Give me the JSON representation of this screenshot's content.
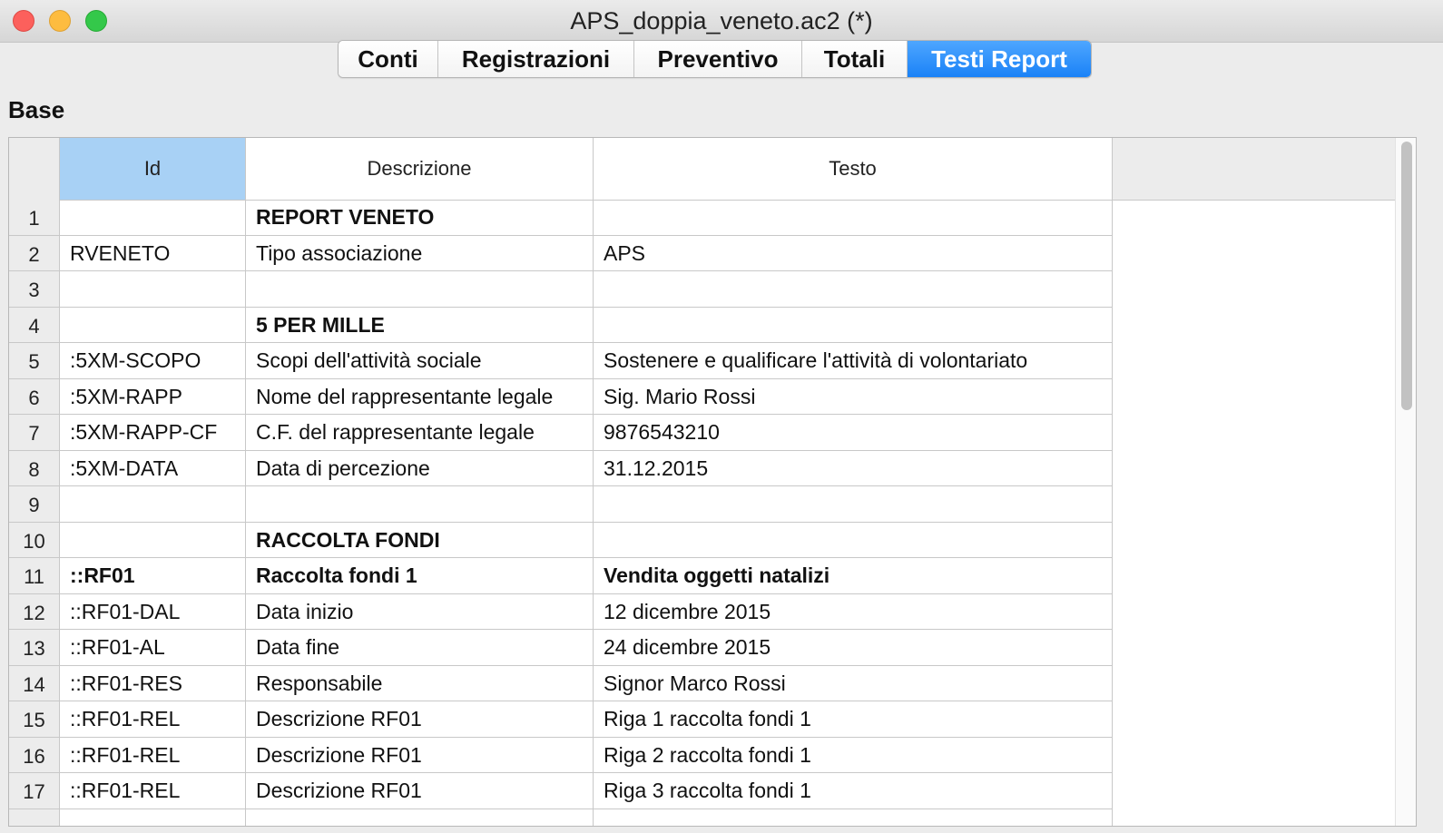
{
  "window": {
    "title": "APS_doppia_veneto.ac2 (*)"
  },
  "tabs": [
    {
      "label": "Conti",
      "active": false
    },
    {
      "label": "Registrazioni",
      "active": false
    },
    {
      "label": "Preventivo",
      "active": false
    },
    {
      "label": "Totali",
      "active": false
    },
    {
      "label": "Testi Report",
      "active": true
    }
  ],
  "section": {
    "title": "Base"
  },
  "table": {
    "columns": [
      "Id",
      "Descrizione",
      "Testo"
    ],
    "selected_column": "Id",
    "rows": [
      {
        "n": "1",
        "id": "",
        "desc": "REPORT VENETO",
        "text": "",
        "bold": true
      },
      {
        "n": "2",
        "id": "RVENETO",
        "desc": "Tipo associazione",
        "text": "APS",
        "bold": false
      },
      {
        "n": "3",
        "id": "",
        "desc": "",
        "text": "",
        "bold": false
      },
      {
        "n": "4",
        "id": "",
        "desc": "5 PER MILLE",
        "text": "",
        "bold": true
      },
      {
        "n": "5",
        "id": ":5XM-SCOPO",
        "desc": "Scopi dell'attività sociale",
        "text": "Sostenere e qualificare l'attività di volontariato",
        "bold": false
      },
      {
        "n": "6",
        "id": ":5XM-RAPP",
        "desc": "Nome del rappresentante legale",
        "text": "Sig. Mario Rossi",
        "bold": false
      },
      {
        "n": "7",
        "id": ":5XM-RAPP-CF",
        "desc": "C.F. del rappresentante legale",
        "text": "9876543210",
        "bold": false
      },
      {
        "n": "8",
        "id": ":5XM-DATA",
        "desc": "Data di percezione",
        "text": "31.12.2015",
        "bold": false
      },
      {
        "n": "9",
        "id": "",
        "desc": "",
        "text": "",
        "bold": false
      },
      {
        "n": "10",
        "id": "",
        "desc": "RACCOLTA FONDI",
        "text": "",
        "bold": true
      },
      {
        "n": "11",
        "id": "::RF01",
        "desc": "Raccolta fondi 1",
        "text": "Vendita oggetti natalizi",
        "bold": true
      },
      {
        "n": "12",
        "id": "::RF01-DAL",
        "desc": "Data inizio",
        "text": "12 dicembre 2015",
        "bold": false
      },
      {
        "n": "13",
        "id": "::RF01-AL",
        "desc": "Data fine",
        "text": "24 dicembre 2015",
        "bold": false
      },
      {
        "n": "14",
        "id": "::RF01-RES",
        "desc": "Responsabile",
        "text": "Signor Marco Rossi",
        "bold": false
      },
      {
        "n": "15",
        "id": "::RF01-REL",
        "desc": "Descrizione RF01",
        "text": "Riga 1 raccolta fondi 1",
        "bold": false
      },
      {
        "n": "16",
        "id": "::RF01-REL",
        "desc": "Descrizione RF01",
        "text": "Riga 2 raccolta fondi 1",
        "bold": false
      },
      {
        "n": "17",
        "id": "::RF01-REL",
        "desc": "Descrizione RF01",
        "text": "Riga 3 raccolta fondi 1",
        "bold": false
      },
      {
        "n": "",
        "id": "",
        "desc": "",
        "text": "",
        "bold": false
      }
    ]
  },
  "colors": {
    "active_tab": "#1a82f7",
    "selected_header": "#a8d1f5"
  }
}
